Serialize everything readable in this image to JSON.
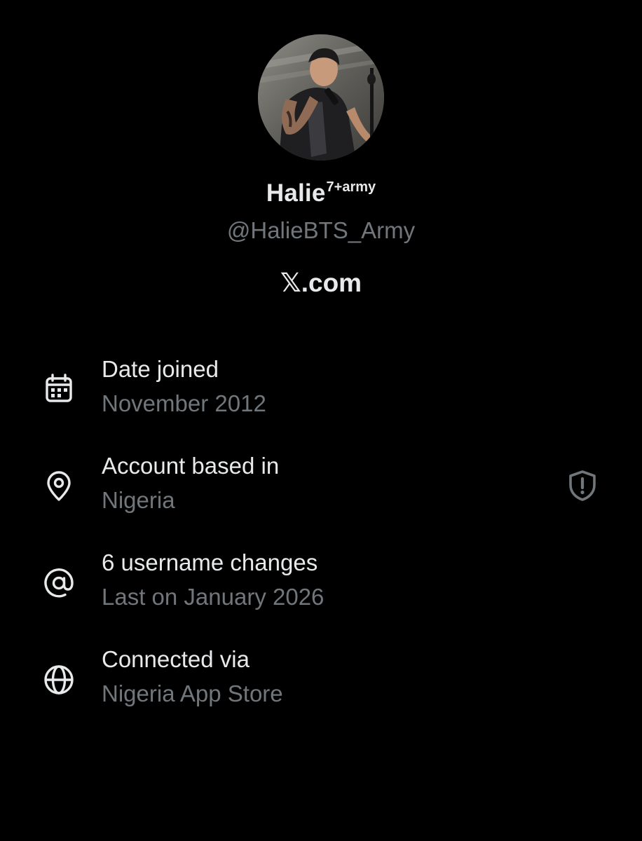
{
  "profile": {
    "display_name": "Halie",
    "display_name_suffix": "7+army",
    "handle": "@HalieBTS_Army",
    "site": "𝕏.com"
  },
  "colors": {
    "background": "#000000",
    "primary_text": "#e7e9ea",
    "secondary_text": "#71767b"
  },
  "info": {
    "items": [
      {
        "icon": "calendar-icon",
        "title": "Date joined",
        "subtitle": "November 2012"
      },
      {
        "icon": "location-pin-icon",
        "title": "Account based in",
        "subtitle": "Nigeria",
        "trailing_icon": "shield-alert-icon"
      },
      {
        "icon": "at-sign-icon",
        "title": "6 username changes",
        "subtitle": "Last on January 2026"
      },
      {
        "icon": "globe-icon",
        "title": "Connected via",
        "subtitle": "Nigeria App Store"
      }
    ]
  }
}
